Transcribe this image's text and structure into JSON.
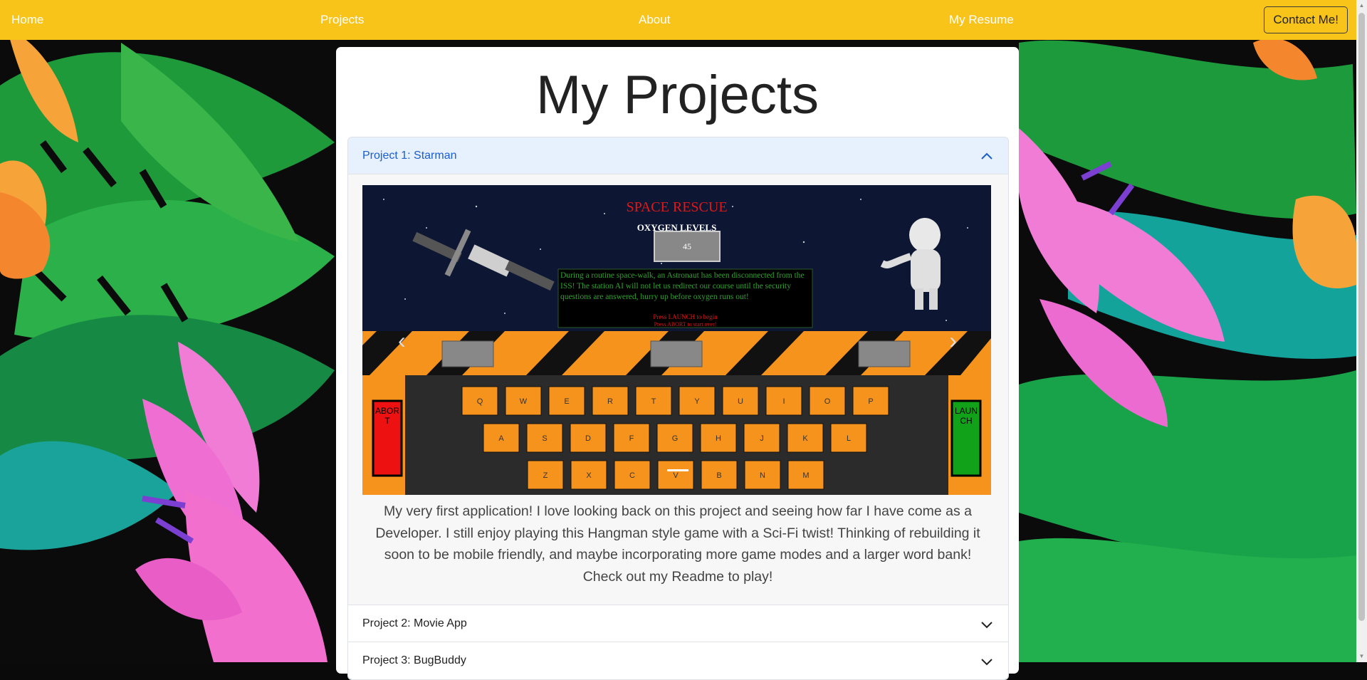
{
  "nav": {
    "home": "Home",
    "projects": "Projects",
    "about": "About",
    "resume": "My Resume",
    "contact": "Contact Me!"
  },
  "page": {
    "title": "My Projects"
  },
  "accordion": {
    "items": [
      {
        "label": "Project 1: Starman",
        "expanded": true
      },
      {
        "label": "Project 2: Movie App",
        "expanded": false
      },
      {
        "label": "Project 3: BugBuddy",
        "expanded": false
      }
    ]
  },
  "project1": {
    "description": "My very first application! I love looking back on this project and seeing how far I have come as a Developer. I still enjoy playing this Hangman style game with a Sci-Fi twist! Thinking of rebuilding it soon to be mobile friendly, and maybe incorporating more game modes and a larger word bank! Check out my Readme to play!"
  },
  "game": {
    "title": "SPACE RESCUE",
    "oxygen_label": "OXYGEN LEVELS",
    "oxygen_value": "45",
    "story": "During a routine space-walk, an Astronaut has been disconnected from the ISS! The station AI will not let us redirect our course until the security questions are answered, hurry up before oxygen runs out!",
    "hint1": "Press LAUNCH to begin",
    "hint2": "Press ABORT to start over!",
    "abort": "ABORT",
    "launch": "LAUNCH",
    "keys_row1": [
      "Q",
      "W",
      "E",
      "R",
      "T",
      "Y",
      "U",
      "I",
      "O",
      "P"
    ],
    "keys_row2": [
      "A",
      "S",
      "D",
      "F",
      "G",
      "H",
      "J",
      "K",
      "L"
    ],
    "keys_row3": [
      "Z",
      "X",
      "C",
      "V",
      "B",
      "N",
      "M"
    ]
  },
  "colors": {
    "navbar": "#f8c41a",
    "accordion_active_bg": "#e7f0fd",
    "accordion_active_text": "#1a5ed0"
  },
  "icons": {
    "chevron_up": "chevron-up-icon",
    "chevron_down": "chevron-down-icon",
    "carousel_prev": "chevron-left-icon",
    "carousel_next": "chevron-right-icon"
  }
}
